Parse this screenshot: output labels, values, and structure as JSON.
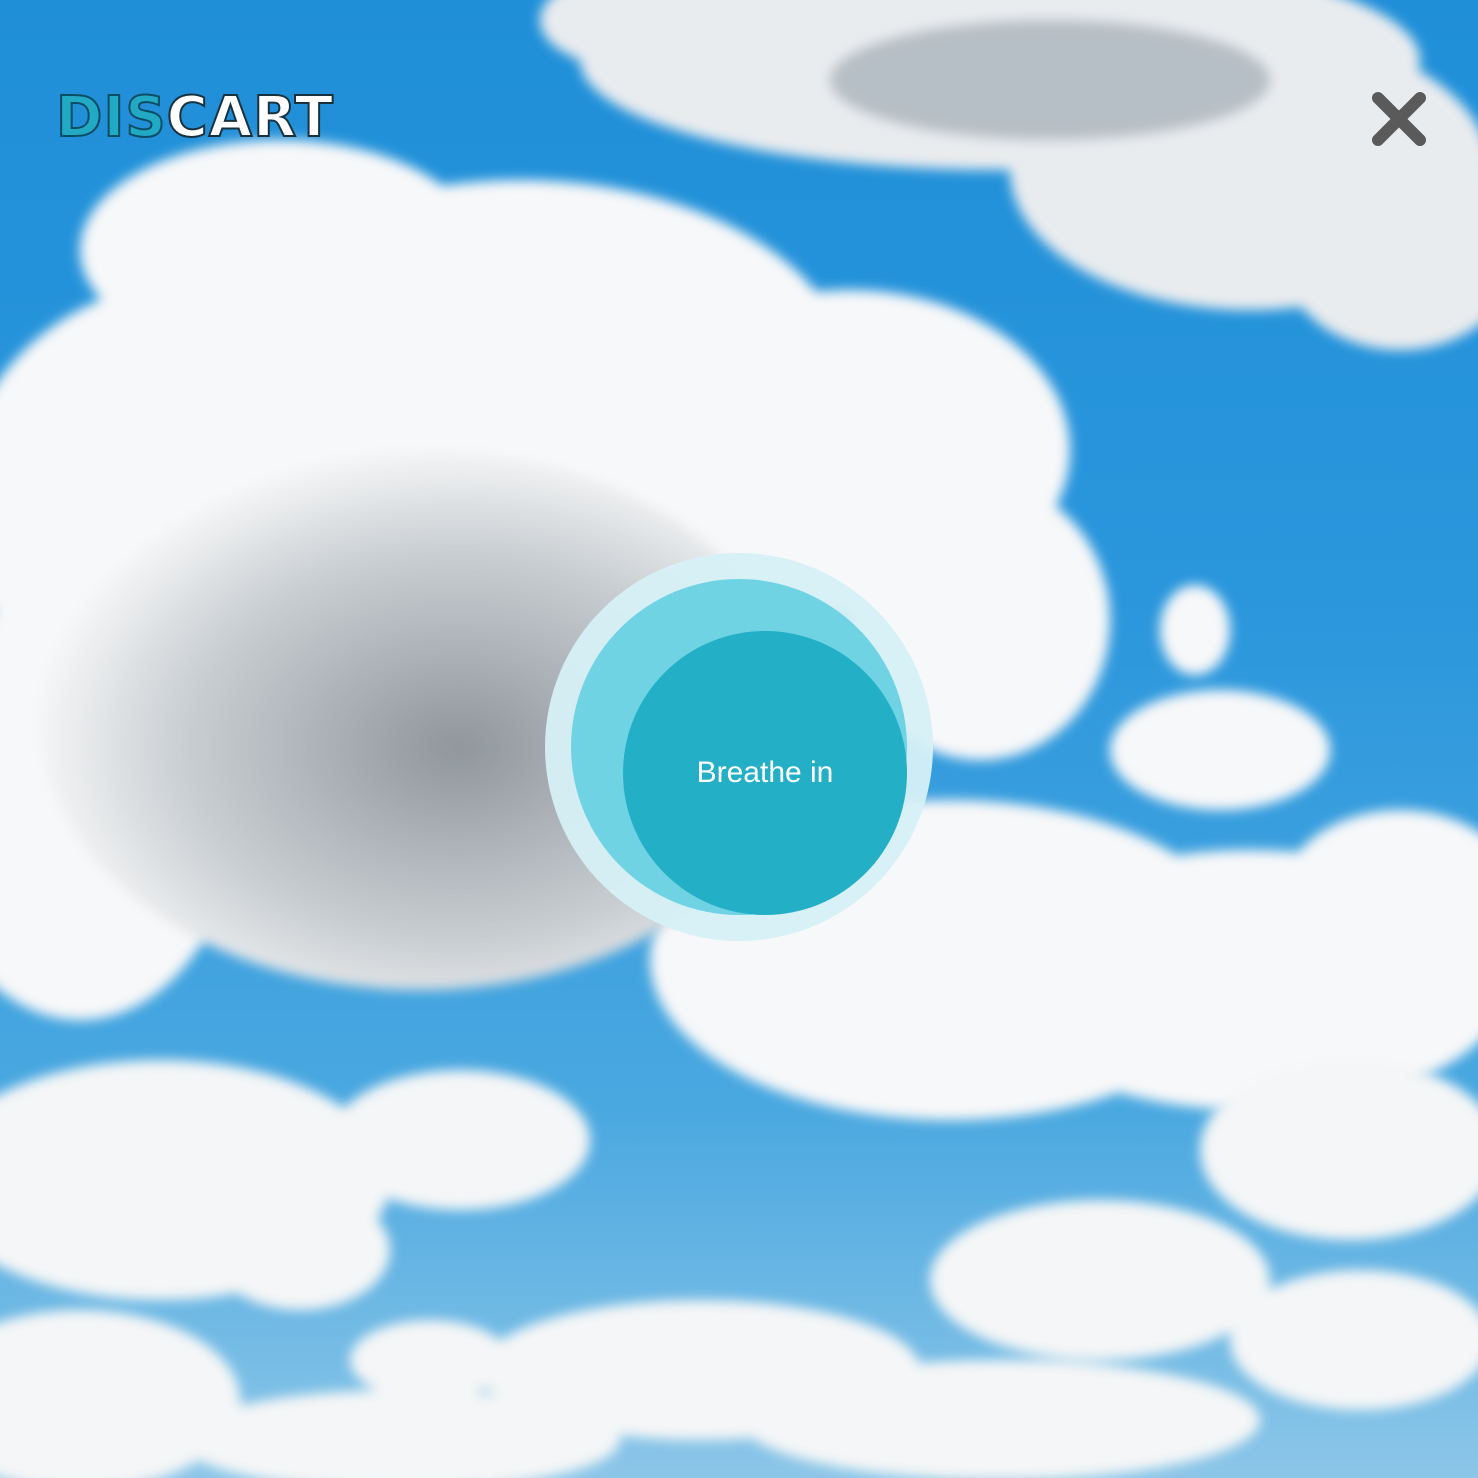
{
  "logo": {
    "part_a": "DIS",
    "part_b": "CART"
  },
  "close_button": {
    "icon": "close-icon"
  },
  "breathing_circle": {
    "label": "Breathe in"
  },
  "background": {
    "icon": "cloudy-sky-image"
  },
  "colors": {
    "accent": "#23b0c7",
    "ring_middle": "#6fd3e4",
    "ring_outer": "#d6f0f6",
    "sky": "#1f8fd8",
    "close_icon": "#5a5a5a"
  }
}
